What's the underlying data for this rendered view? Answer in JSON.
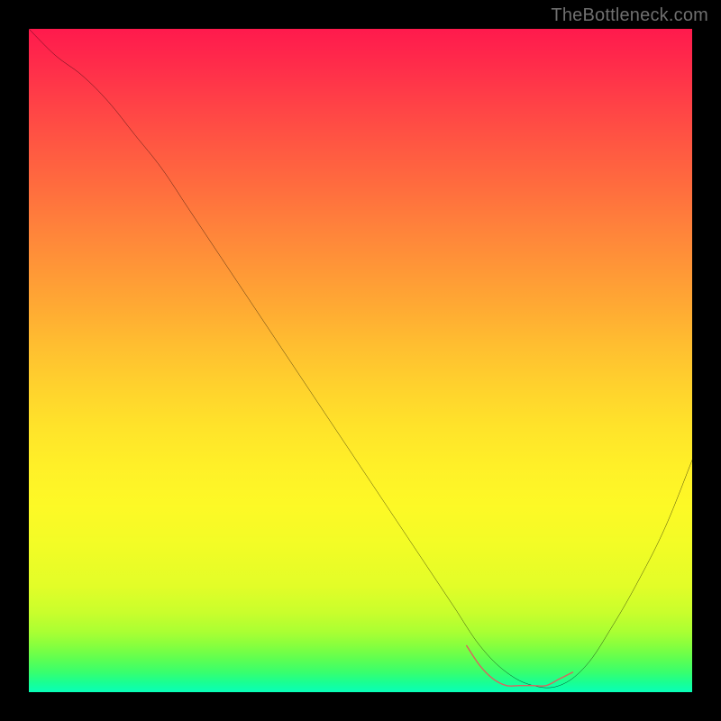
{
  "watermark": {
    "text": "TheBottleneck.com"
  },
  "chart_data": {
    "type": "line",
    "title": "",
    "xlabel": "",
    "ylabel": "",
    "xlim": [
      0,
      100
    ],
    "ylim": [
      0,
      100
    ],
    "grid": false,
    "legend": false,
    "notes": "y-axis inverted visually (0 at bottom = green/best, 100 at top = red/worst). Background is a vertical gradient red→yellow→green. Values are estimated from pixel positions; curve descends from top-left, flat-ish minimum ~x 68–80, then rises. A short salmon highlight segment sits on the curve at the minimum region.",
    "series": [
      {
        "name": "bottleneck-curve",
        "color": "#000000",
        "x": [
          0,
          4,
          8,
          12,
          16,
          20,
          24,
          28,
          32,
          36,
          40,
          44,
          48,
          52,
          56,
          60,
          64,
          68,
          72,
          76,
          80,
          84,
          88,
          92,
          96,
          100
        ],
        "y": [
          100,
          96,
          93,
          89,
          84,
          79,
          73,
          67,
          61,
          55,
          49,
          43,
          37,
          31,
          25,
          19,
          13,
          7,
          3,
          1,
          1,
          4,
          10,
          17,
          25,
          35
        ]
      },
      {
        "name": "highlight-min-segment",
        "color": "#d9655f",
        "x": [
          66,
          68,
          70,
          72,
          74,
          76,
          78,
          80,
          82
        ],
        "y": [
          7,
          4,
          2,
          1,
          1,
          1,
          1,
          2,
          3
        ]
      }
    ]
  }
}
